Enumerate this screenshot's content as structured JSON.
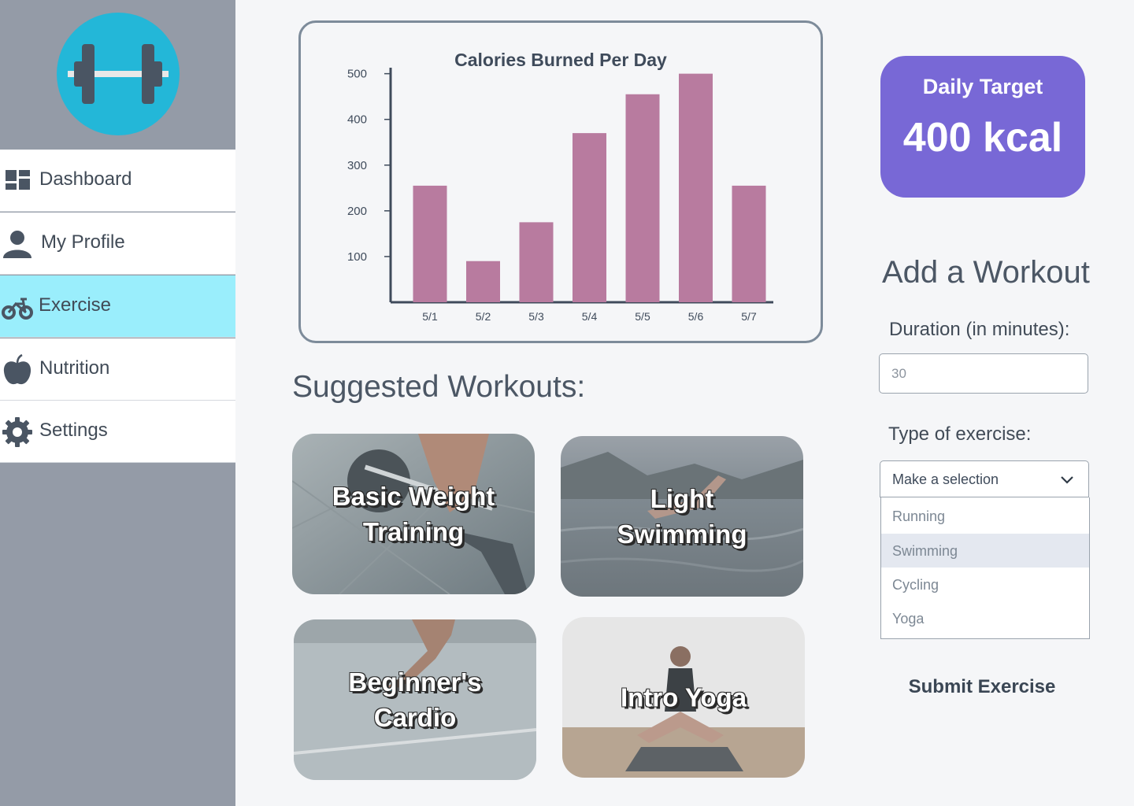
{
  "sidebar": {
    "logo_icon": "dumbbell-icon",
    "items": [
      {
        "label": "Dashboard",
        "icon": "dashboard-icon"
      },
      {
        "label": "My Profile",
        "icon": "user-icon"
      },
      {
        "label": "Exercise",
        "icon": "bicycle-icon",
        "active": true
      },
      {
        "label": "Nutrition",
        "icon": "apple-icon"
      },
      {
        "label": "Settings",
        "icon": "gear-icon"
      }
    ]
  },
  "chart_data": {
    "type": "bar",
    "title": "Calories Burned Per Day",
    "categories": [
      "5/1",
      "5/2",
      "5/3",
      "5/4",
      "5/5",
      "5/6",
      "5/7"
    ],
    "values": [
      255,
      90,
      175,
      370,
      455,
      500,
      255
    ],
    "yticks": [
      100,
      200,
      300,
      400,
      500
    ],
    "ylim": [
      0,
      520
    ],
    "bar_color": "#b87b9f",
    "xlabel": "",
    "ylabel": "",
    "grid": false
  },
  "suggested": {
    "title": "Suggested Workouts:",
    "cards": [
      {
        "label": "Basic Weight Training"
      },
      {
        "label": "Light Swimming"
      },
      {
        "label": "Beginner's Cardio"
      },
      {
        "label": "Intro Yoga"
      }
    ]
  },
  "target": {
    "label": "Daily Target",
    "value": "400 kcal",
    "color": "#7868d6"
  },
  "form": {
    "title": "Add a Workout",
    "duration_label": "Duration (in minutes):",
    "duration_placeholder": "30",
    "type_label": "Type of exercise:",
    "select_text": "Make a selection",
    "options": [
      "Running",
      "Swimming",
      "Cycling",
      "Yoga"
    ],
    "highlighted_option": "Swimming",
    "submit_label": "Submit Exercise"
  }
}
